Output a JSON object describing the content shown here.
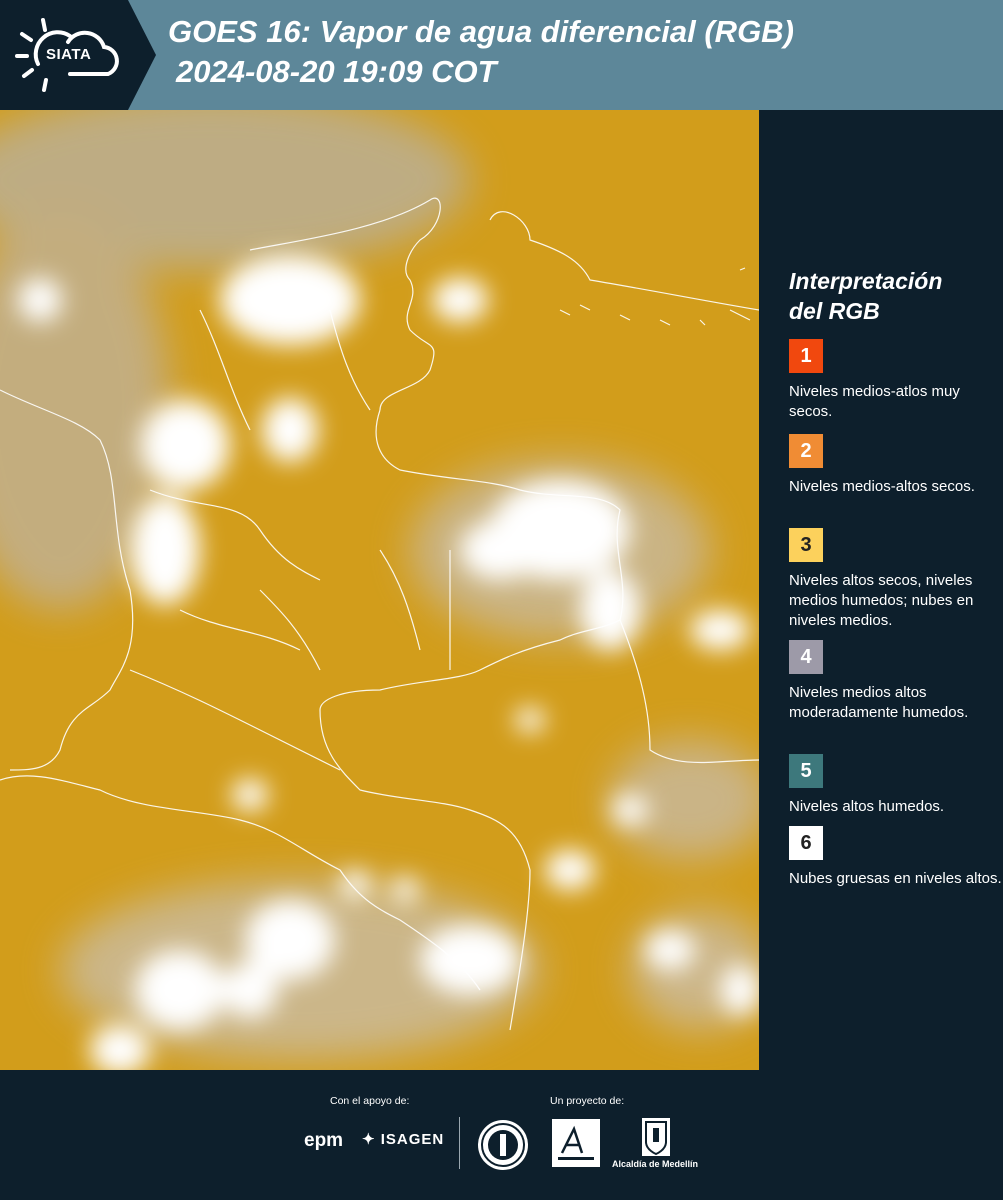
{
  "header": {
    "logo_text": "SIATA",
    "title_line1": "GOES 16: Vapor de agua diferencial (RGB)",
    "title_line2": "2024-08-20 19:09 COT"
  },
  "sidebar": {
    "title_line1": "Interpretación",
    "title_line2": "del RGB",
    "legend": [
      {
        "num": "1",
        "color": "#f1480e",
        "text": "Niveles medios-atlos muy secos."
      },
      {
        "num": "2",
        "color": "#f08c34",
        "text": "Niveles medios-altos secos."
      },
      {
        "num": "3",
        "color": "#fcd15c",
        "text": "Niveles altos secos, niveles medios humedos; nubes en niveles medios."
      },
      {
        "num": "4",
        "color": "#9d9aa8",
        "text": "Niveles medios altos moderadamente humedos."
      },
      {
        "num": "5",
        "color": "#3d787c",
        "text": "Niveles altos humedos."
      },
      {
        "num": "6",
        "color": "#ffffff",
        "text": "Nubes gruesas en niveles altos."
      }
    ]
  },
  "footer": {
    "support_label": "Con el apoyo de:",
    "project_label": "Un proyecto de:",
    "sponsor1": "epm",
    "sponsor2": "ISAGEN",
    "partner_label": "Alcaldía de Medellín"
  },
  "colors": {
    "header_bg": "#5d8799",
    "panel_bg": "#0d1f2c",
    "map_dry": "#d29d1b",
    "map_cloud": "#ffffff"
  }
}
